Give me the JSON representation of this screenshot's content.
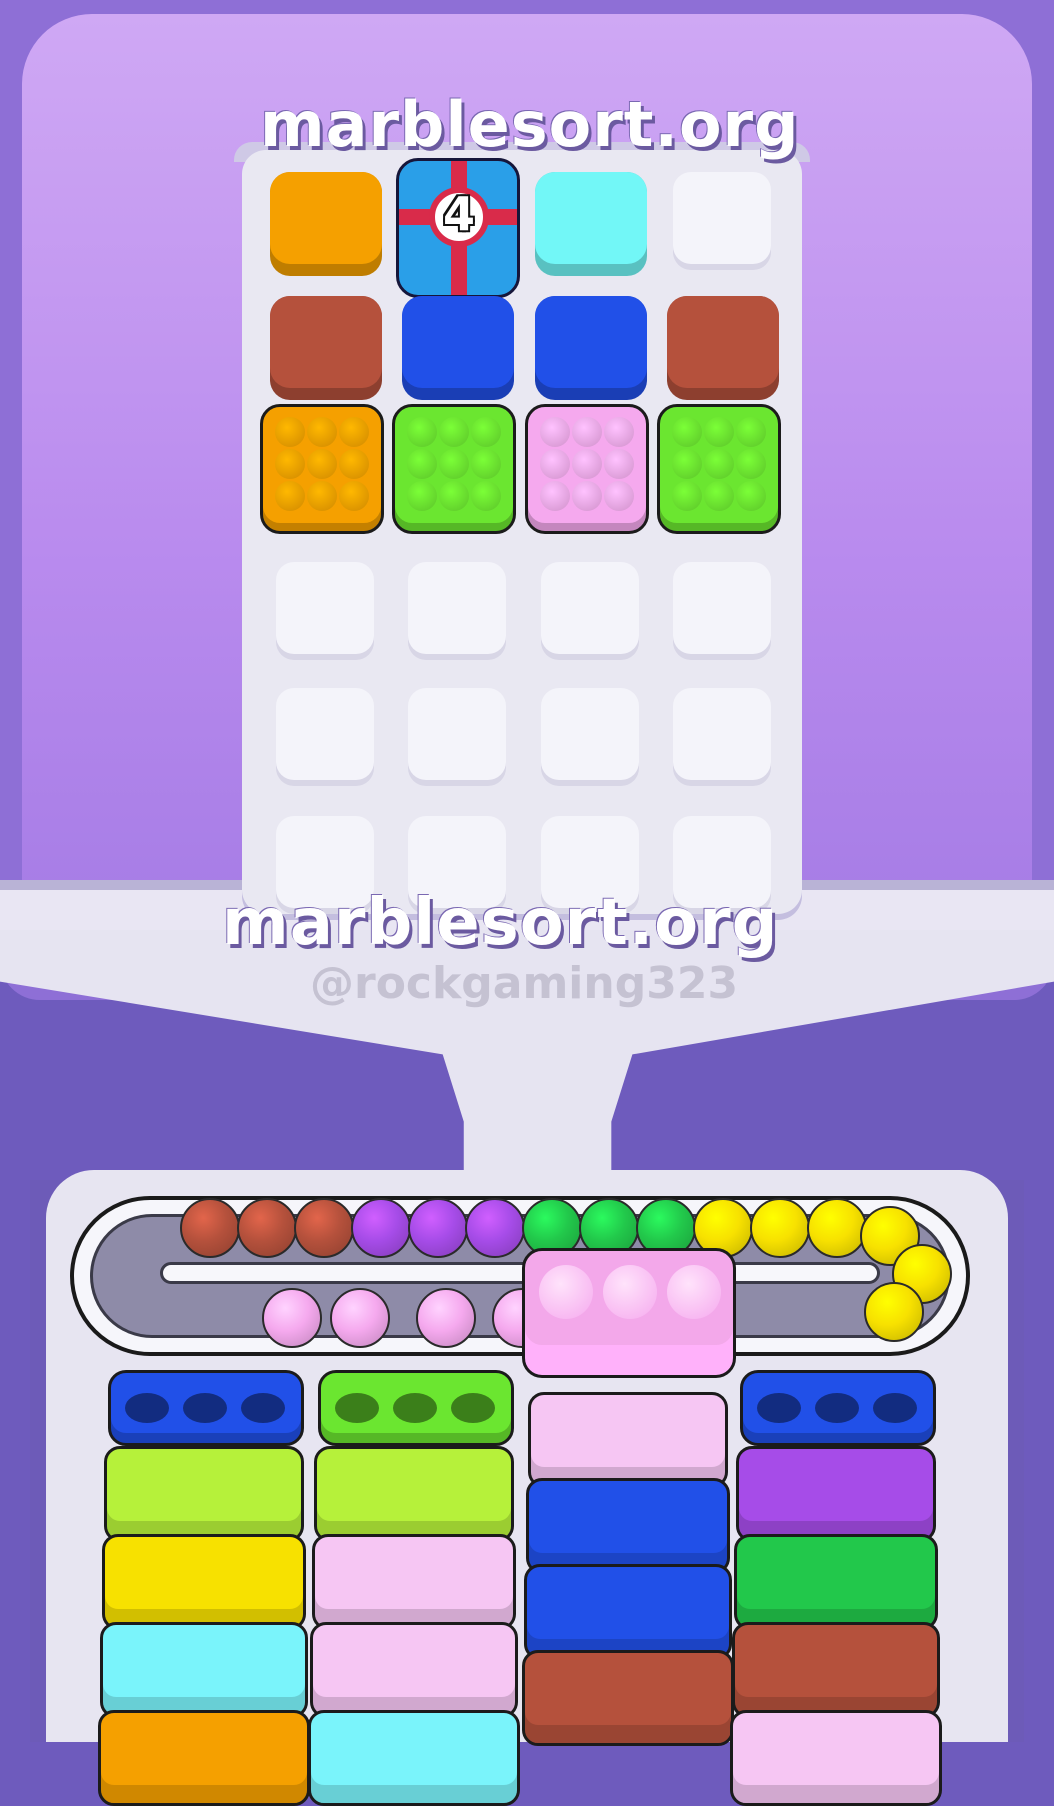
{
  "watermarks": {
    "top": "marblesort.org",
    "middle": "marblesort.org",
    "handle": "@rockgaming323"
  },
  "gift_counter": "4",
  "colors": {
    "orange": "#f5a000",
    "cyan": "#72f7f7",
    "brown": "#b5513c",
    "blue": "#2150e8",
    "green": "#6be630",
    "pink": "#f5a9ee",
    "purple": "#a64ce8",
    "yellow": "#f7e100",
    "lime": "#b6f13a",
    "dark_green": "#22c84b",
    "light_pink": "#f6c6f3",
    "light_cyan": "#7af4fb"
  },
  "board_rows": [
    [
      "orange",
      "gift",
      "cyan",
      "empty"
    ],
    [
      "brown",
      "blue",
      "blue",
      "brown"
    ],
    [
      "crate-orange",
      "crate-green",
      "crate-pink",
      "crate-green"
    ],
    [
      "empty",
      "empty",
      "empty",
      "empty"
    ],
    [
      "empty",
      "empty",
      "empty",
      "empty"
    ],
    [
      "empty",
      "empty",
      "empty",
      "empty"
    ]
  ],
  "conveyor_marbles": [
    "brown",
    "brown",
    "brown",
    "purple",
    "purple",
    "purple",
    "dark_green",
    "dark_green",
    "dark_green",
    "yellow",
    "yellow",
    "yellow",
    "yellow",
    "yellow",
    "yellow"
  ],
  "lower_marbles": [
    "pink",
    "pink",
    "pink",
    "pink"
  ],
  "holder": {
    "color": "pink",
    "slots": 3
  },
  "columns": [
    {
      "cap": "blue",
      "stack": [
        "lime",
        "yellow",
        "light_cyan",
        "orange"
      ]
    },
    {
      "cap": "green",
      "stack": [
        "lime",
        "light_pink",
        "light_pink",
        "light_cyan"
      ]
    },
    {
      "cap": "none",
      "stack": [
        "light_pink",
        "blue",
        "blue",
        "brown"
      ]
    },
    {
      "cap": "blue",
      "stack": [
        "purple",
        "dark_green",
        "brown",
        "light_pink"
      ]
    }
  ]
}
